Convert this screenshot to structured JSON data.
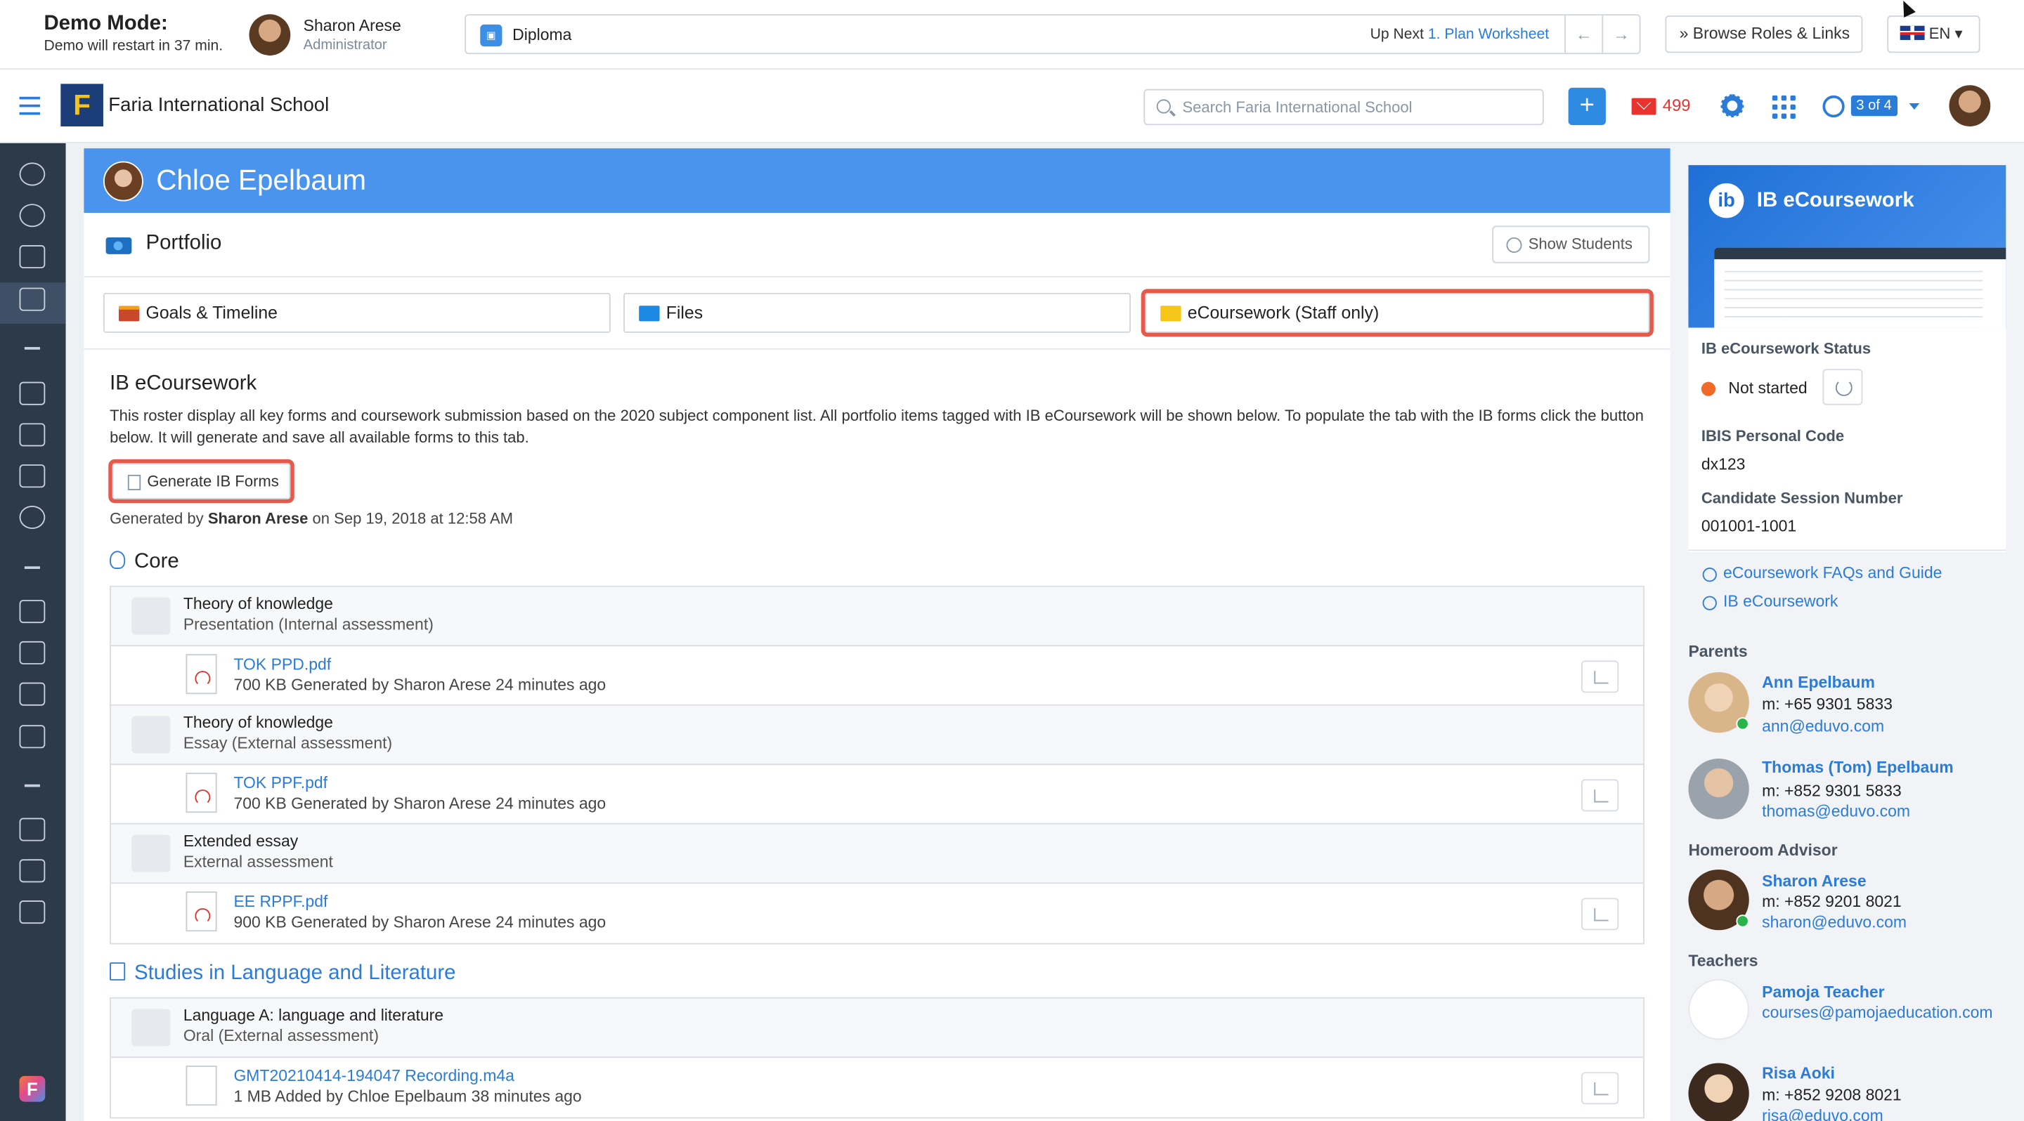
{
  "demo": {
    "title": "Demo Mode:",
    "subtitle": "Demo will restart in 37 min.",
    "user_name": "Sharon Arese",
    "user_role": "Administrator"
  },
  "upnext": {
    "program": "Diploma",
    "label": "Up Next",
    "link": "1. Plan Worksheet",
    "prev_icon": "arrow-left-icon",
    "next_icon": "arrow-right-icon"
  },
  "browse_roles": "Browse Roles & Links",
  "language": "EN",
  "nav": {
    "school": "Faria International School",
    "logo_letter": "F",
    "search_placeholder": "Search Faria International School",
    "add_label": "+",
    "mail_count": "499",
    "school_counter": "3 of 4"
  },
  "student": {
    "name": "Chloe Epelbaum"
  },
  "portfolio": {
    "title": "Portfolio",
    "show_students": "Show Students"
  },
  "tabs": [
    {
      "label": "Goals & Timeline",
      "color": "#c9472b"
    },
    {
      "label": "Files",
      "color": "#1e88e5"
    },
    {
      "label": "eCoursework (Staff only)",
      "color": "#f5c518"
    }
  ],
  "ecoursework": {
    "title": "IB eCoursework",
    "description": "This roster display all key forms and coursework submission based on the 2020 subject component list. All portfolio items tagged with IB eCoursework will be shown below. To populate the tab with the IB forms click the button below. It will generate and save all available forms to this tab.",
    "generate_button": "Generate IB Forms",
    "generated_prefix": "Generated by",
    "generated_by": "Sharon Arese",
    "generated_suffix": "on Sep 19, 2018 at 12:58 AM"
  },
  "groups": [
    {
      "title": "Core",
      "color": "#222222",
      "rows": [
        {
          "type": "component",
          "name": "Theory of knowledge",
          "sub": "Presentation (Internal assessment)"
        },
        {
          "type": "file",
          "file": "TOK PPD.pdf",
          "meta": "700 KB Generated by Sharon Arese 24 minutes ago"
        },
        {
          "type": "component",
          "name": "Theory of knowledge",
          "sub": "Essay (External assessment)"
        },
        {
          "type": "file",
          "file": "TOK PPF.pdf",
          "meta": "700 KB Generated by Sharon Arese 24 minutes ago"
        },
        {
          "type": "component",
          "name": "Extended essay",
          "sub": "External assessment"
        },
        {
          "type": "file",
          "file": "EE RPPF.pdf",
          "meta": "900 KB Generated by Sharon Arese 24 minutes ago"
        }
      ]
    },
    {
      "title": "Studies in Language and Literature",
      "color": "#2b7bd8",
      "rows": [
        {
          "type": "component",
          "name": "Language A: language and literature",
          "sub": "Oral (External assessment)"
        },
        {
          "type": "doc",
          "file": "GMT20210414-194047 Recording.m4a",
          "meta": "1 MB Added by Chloe Epelbaum 38 minutes ago"
        }
      ]
    }
  ],
  "right": {
    "promo_title": "IB eCoursework",
    "promo_badge": "ib",
    "status_label": "IB eCoursework Status",
    "status_value": "Not started",
    "ibis_label": "IBIS Personal Code",
    "ibis_value": "dx123",
    "session_label": "Candidate Session Number",
    "session_value": "001001-1001",
    "links": [
      "eCoursework FAQs and Guide",
      "IB eCoursework"
    ],
    "parents_label": "Parents",
    "parents": [
      {
        "name": "Ann Epelbaum",
        "phone": "m: +65 9301 5833",
        "email": "ann@eduvo.com"
      },
      {
        "name": "Thomas (Tom) Epelbaum",
        "phone": "m: +852 9301 5833",
        "email": "thomas@eduvo.com"
      }
    ],
    "advisor_label": "Homeroom Advisor",
    "advisor": {
      "name": "Sharon Arese",
      "phone": "m: +852 9201 8021",
      "email": "sharon@eduvo.com"
    },
    "teachers_label": "Teachers",
    "teachers": [
      {
        "name": "Pamoja Teacher",
        "email": "courses@pamojaeducation.com"
      },
      {
        "name": "Risa Aoki",
        "phone": "m: +852 9208 8021",
        "email": "risa@eduvo.com"
      }
    ]
  },
  "colors": {
    "accent": "#2b7bd8",
    "banner": "#4a94ee",
    "sidebar": "#2d3a4a",
    "highlight": "#e55a4a",
    "mail": "#e8332f"
  }
}
